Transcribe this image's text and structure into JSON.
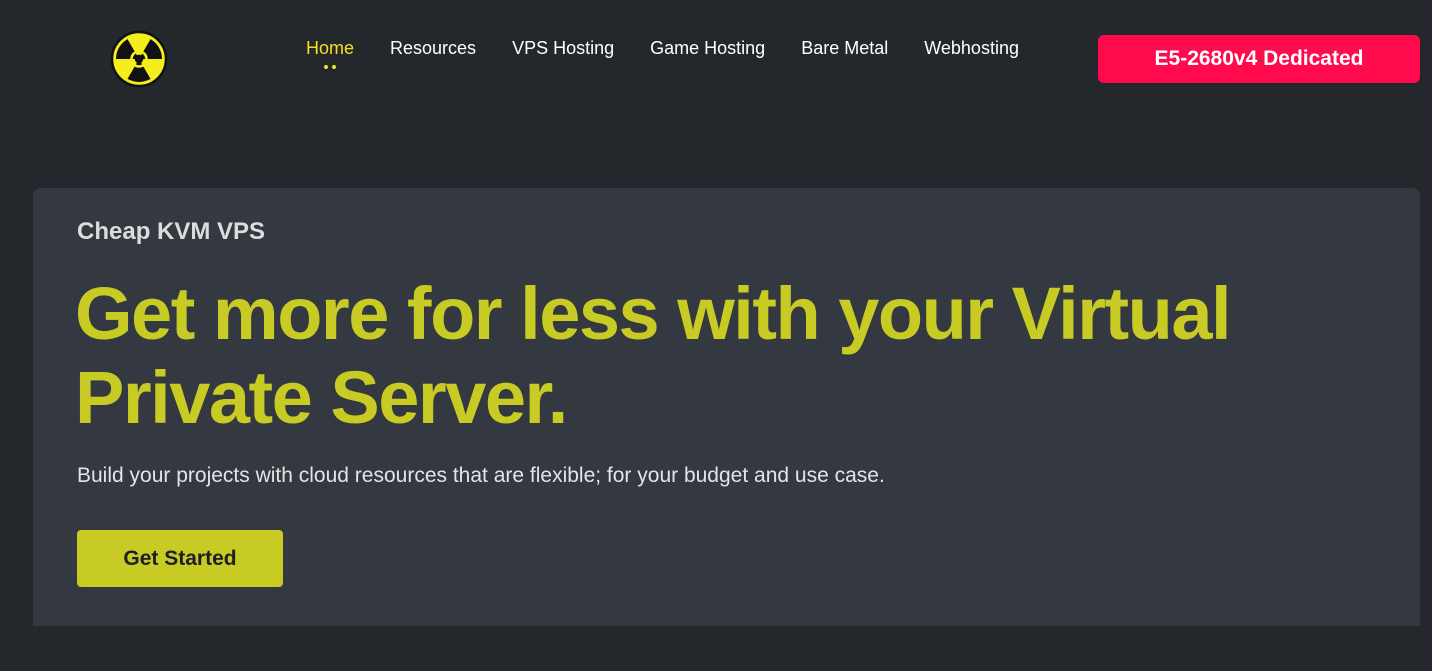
{
  "header": {
    "logo_icon": "radiation-icon",
    "nav": [
      {
        "label": "Home",
        "active": true
      },
      {
        "label": "Resources",
        "active": false
      },
      {
        "label": "VPS Hosting",
        "active": false
      },
      {
        "label": "Game Hosting",
        "active": false
      },
      {
        "label": "Bare Metal",
        "active": false
      },
      {
        "label": "Webhosting",
        "active": false
      }
    ],
    "cta_label": "E5-2680v4 Dedicated"
  },
  "hero": {
    "eyebrow": "Cheap KVM VPS",
    "headline": "Get more for less with your Virtual Private Server.",
    "subtext": "Build your projects with cloud resources that are flexible; for your budget and use case.",
    "button_label": "Get Started"
  },
  "colors": {
    "background": "#24272c",
    "card": "#343840",
    "accent_yellow": "#c8cb24",
    "nav_active": "#f2e11a",
    "cta_red": "#ff0a4d"
  }
}
